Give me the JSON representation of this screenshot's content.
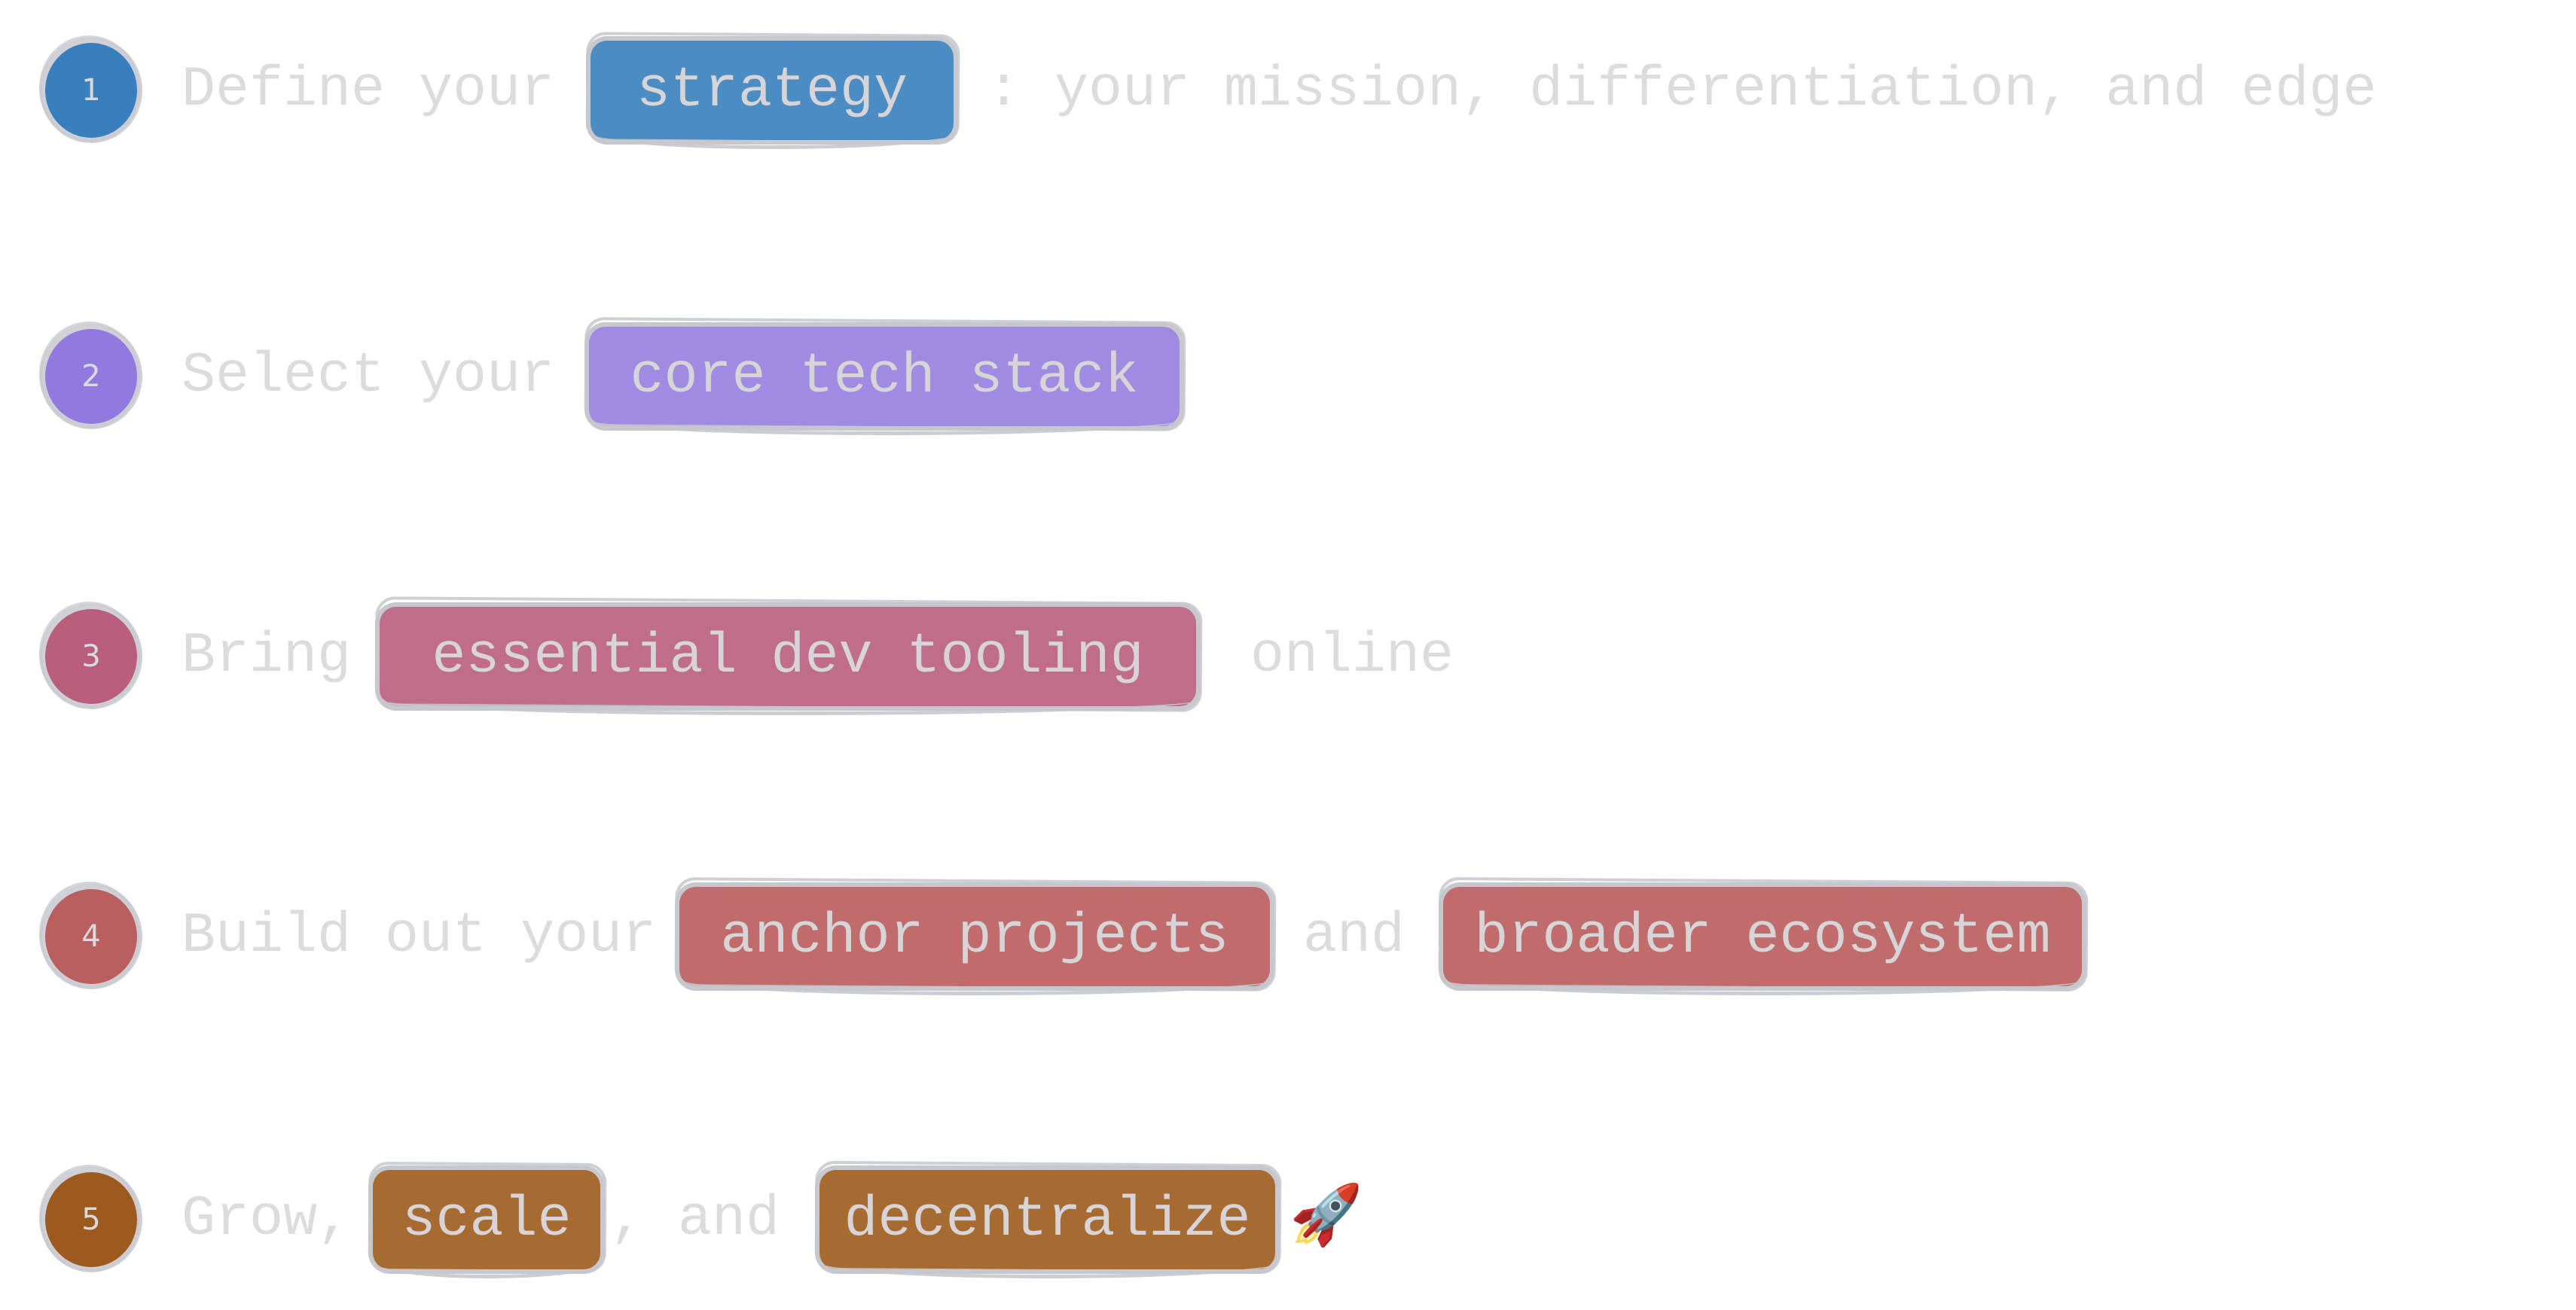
{
  "steps": [
    {
      "number": "1",
      "color": "#3a7fbd",
      "box_color": "#4b8cc2",
      "prefix": "Define your",
      "highlights": [
        "strategy"
      ],
      "suffix": ": your mission, differentiation, and edge"
    },
    {
      "number": "2",
      "color": "#9179e0",
      "box_color": "#a08ae2",
      "prefix": "Select your",
      "highlights": [
        "core tech stack"
      ]
    },
    {
      "number": "3",
      "color": "#b85e7c",
      "box_color": "#bf6d88",
      "prefix": "Bring",
      "highlights": [
        "essential dev tooling"
      ],
      "suffix": "online"
    },
    {
      "number": "4",
      "color": "#bb5e5f",
      "box_color": "#c06b6c",
      "prefix": "Build out your",
      "highlights": [
        "anchor projects",
        "broader ecosystem"
      ],
      "connector": "and"
    },
    {
      "number": "5",
      "color": "#9c5a1e",
      "box_color": "#a76a31",
      "prefix": "Grow,",
      "highlights": [
        "scale",
        "decentralize"
      ],
      "connector": ", and",
      "trailing_icon": "🚀"
    }
  ]
}
